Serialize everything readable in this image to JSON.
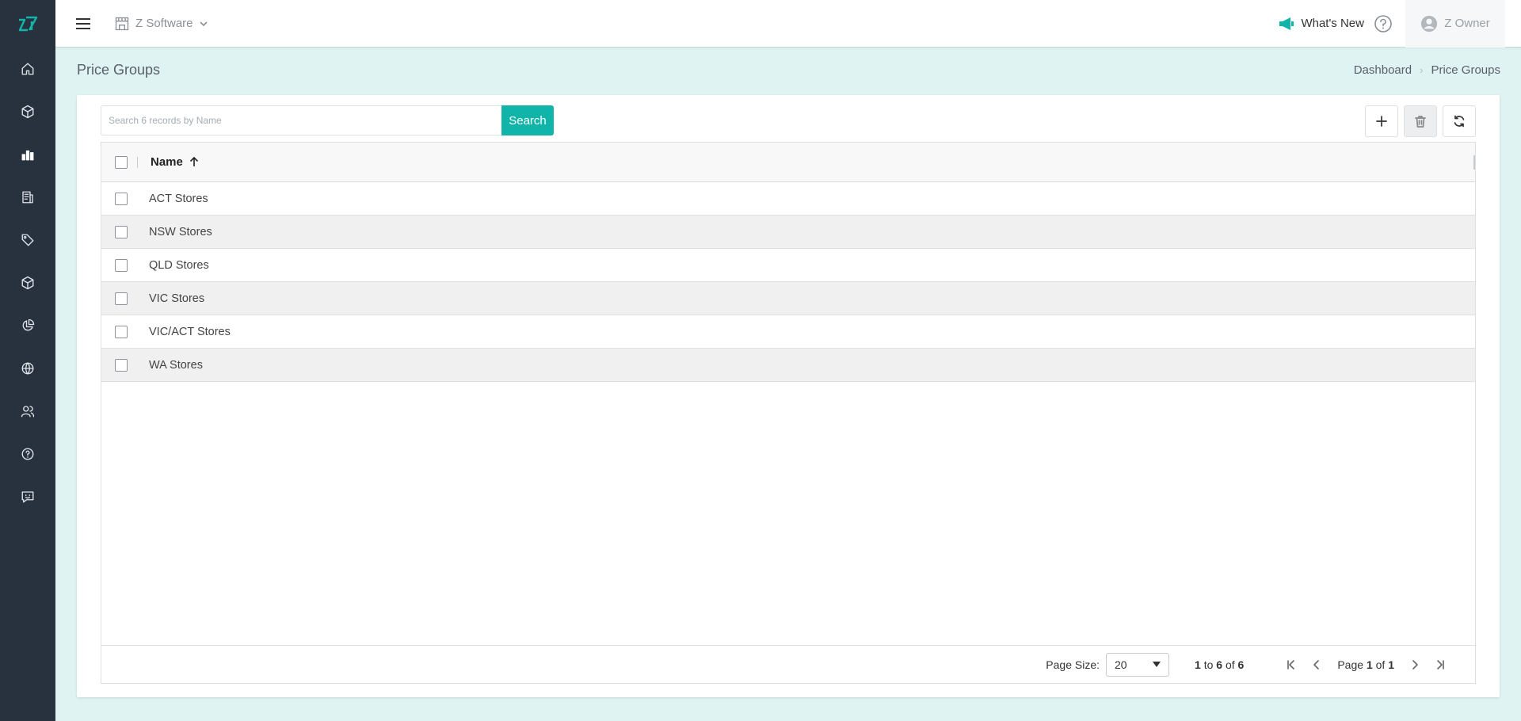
{
  "sidebar": {
    "logo": "z-logo-icon",
    "items": [
      {
        "icon": "home-icon"
      },
      {
        "icon": "box-icon"
      },
      {
        "icon": "bar-chart-icon"
      },
      {
        "icon": "report-icon"
      },
      {
        "icon": "tag-icon"
      },
      {
        "icon": "package-icon"
      },
      {
        "icon": "pie-chart-icon"
      },
      {
        "icon": "globe-icon"
      },
      {
        "icon": "users-icon"
      },
      {
        "icon": "help-circle-icon"
      },
      {
        "icon": "feedback-icon"
      }
    ]
  },
  "header": {
    "company": "Z Software",
    "whats_new": "What's New",
    "user": "Z Owner",
    "accent_color": "#11b4a8"
  },
  "page": {
    "title": "Price Groups",
    "breadcrumb": [
      "Dashboard",
      "Price Groups"
    ]
  },
  "search": {
    "placeholder": "Search 6 records by Name",
    "value": "",
    "button_label": "Search"
  },
  "grid": {
    "column_name": "Name",
    "rows": [
      "ACT Stores",
      "NSW Stores",
      "QLD Stores",
      "VIC Stores",
      "VIC/ACT Stores",
      "WA Stores"
    ]
  },
  "footer": {
    "page_size_label": "Page Size:",
    "page_size": "20",
    "range_from": "1",
    "range_to_word": "to",
    "range_to": "6",
    "range_of_word": "of",
    "range_total": "6",
    "page_word": "Page",
    "page_current": "1",
    "page_of_word": "of",
    "page_total": "1"
  }
}
